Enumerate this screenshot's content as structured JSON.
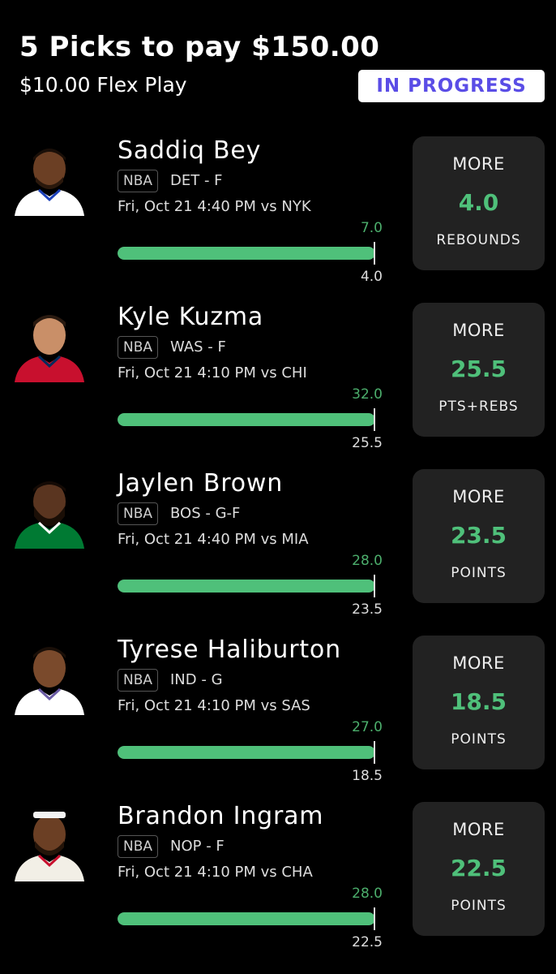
{
  "header": {
    "title": "5 Picks to pay $150.00",
    "subtitle": "$10.00 Flex Play",
    "status": "IN PROGRESS"
  },
  "picks": [
    {
      "name": "Saddiq Bey",
      "league": "NBA",
      "team_pos": "DET - F",
      "game": "Fri, Oct 21 4:40 PM  vs NYK",
      "actual": "7.0",
      "line": "4.0",
      "direction": "MORE",
      "stat": "REBOUNDS",
      "progress": 1.0,
      "jersey_color": "#ffffff",
      "trim_color": "#1d42ba"
    },
    {
      "name": "Kyle Kuzma",
      "league": "NBA",
      "team_pos": "WAS - F",
      "game": "Fri, Oct 21 4:10 PM  vs CHI",
      "actual": "32.0",
      "line": "25.5",
      "direction": "MORE",
      "stat": "PTS+REBS",
      "progress": 1.0,
      "jersey_color": "#c8102e",
      "trim_color": "#002b5c"
    },
    {
      "name": "Jaylen Brown",
      "league": "NBA",
      "team_pos": "BOS - G-F",
      "game": "Fri, Oct 21 4:40 PM  vs MIA",
      "actual": "28.0",
      "line": "23.5",
      "direction": "MORE",
      "stat": "POINTS",
      "progress": 1.0,
      "jersey_color": "#007a33",
      "trim_color": "#ffffff"
    },
    {
      "name": "Tyrese Haliburton",
      "league": "NBA",
      "team_pos": "IND - G",
      "game": "Fri, Oct 21 4:10 PM  vs SAS",
      "actual": "27.0",
      "line": "18.5",
      "direction": "MORE",
      "stat": "POINTS",
      "progress": 1.0,
      "jersey_color": "#ffffff",
      "trim_color": "#6b5ca5"
    },
    {
      "name": "Brandon Ingram",
      "league": "NBA",
      "team_pos": "NOP - F",
      "game": "Fri, Oct 21 4:10 PM  vs CHA",
      "actual": "28.0",
      "line": "22.5",
      "direction": "MORE",
      "stat": "POINTS",
      "progress": 1.0,
      "jersey_color": "#f2efe6",
      "trim_color": "#c8102e"
    }
  ],
  "colors": {
    "accent_green": "#4fc07a",
    "badge_text": "#5a4de6",
    "card_bg": "#222222"
  }
}
